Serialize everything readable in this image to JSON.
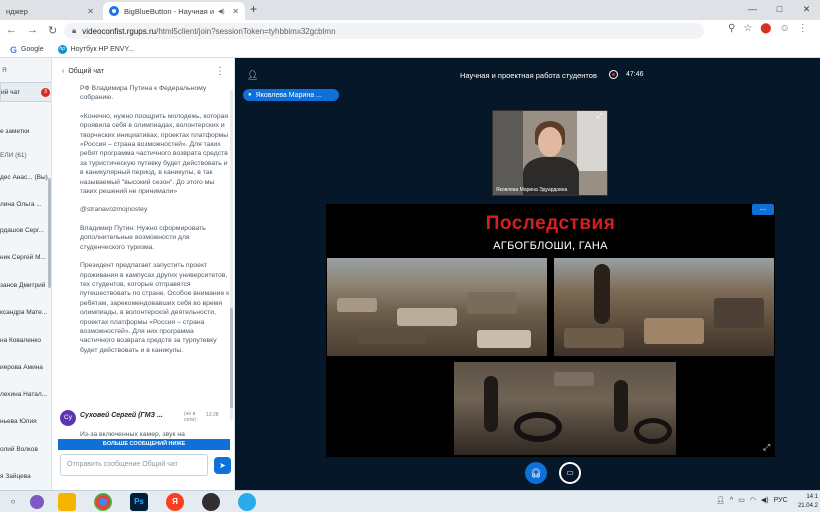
{
  "browser": {
    "tabs": [
      {
        "label": "нджер",
        "icon": "tab-icon"
      },
      {
        "label": "BigBlueButton - Научная и",
        "icon": "bbb-favicon"
      }
    ],
    "new_tab": "+",
    "window_controls": [
      "—",
      "□",
      "✕"
    ],
    "url_host": "videoconfist.rgups.ru",
    "url_path": "/html5client/join?sessionToken=tyhbbimx32gcblmn",
    "bookmarks": [
      {
        "label": "Google",
        "icon": "google-logo"
      },
      {
        "label": "Ноутбук HP ENVY...",
        "icon": "hp-logo"
      }
    ],
    "toolbar_icons": [
      "search-icon",
      "star-icon",
      "extension-icon",
      "profile-icon",
      "menu-icon"
    ]
  },
  "userlist": {
    "section_messages": "Я",
    "chat_item": "ий чат",
    "chat_badge": "3",
    "notes": "е заметки",
    "users_header": "ЕЛИ (61)",
    "users": [
      "дес Анас... (Вы)",
      "лина Ольга ...",
      "рдашов Серг...",
      "ник Сергей М...",
      "занов Дмитрий",
      "ксандра Мате...",
      "на Коваленко",
      "иерова Амина",
      "лехина Натал...",
      "ньева Юлия",
      "олий Волков",
      "я Зайцева"
    ]
  },
  "chat": {
    "title": "Общий чат",
    "messages": [
      "РФ Владимира Путина к Федеральному собранию.",
      "«Конечно, нужно поощрить молодежь, которая проявила себя в олимпиадах, волонтерских и творческих инициативах, проектах платформы «Россия – страна возможностей». Для таких ребят программа частичного возврата средств за туристическую путевку будет действовать и в каникулярный период, в каникулы, в так называемый \"высокий сезон\". До этого мы таких решений не принимали»",
      "@stranavozmojnostey",
      "Владимир Путин: Нужно сформировать дополнительные возможности для студенческого туризма.",
      "Президент предлагает запустить проект проживания в кампусах других университетов, тех студентов, которые отправятся путешествовать по стране. Особое внимание к ребятам, зарекомендовавших себя во время олимпиады, в волонтерской деятельности, проектах платформы «Россия – страна возможностей». Для них программа частичного возврата средств за турпутевку будет действовать и в каникулы."
    ],
    "last_sender": {
      "initials": "Су",
      "name": "Суховей Сергей (ГМЗ ...",
      "time_a": "(не в сети)",
      "time_b": "13:28"
    },
    "last_message": "Из-за включенных камер, звук на",
    "more_messages": "БОЛЬШЕ СООБЩЕНИЙ НИЖЕ",
    "input_placeholder": "Отправить сообщение Общий чат"
  },
  "meeting": {
    "title": "Научная и проектная работа студентов",
    "recording_time": "47:46",
    "talker": "Яковлева Марина ...",
    "webcam_name": "Яковлева Марина Эдуардовна",
    "slide_title": "Последствия",
    "slide_subtitle": "АГБОГБЛОШИ, ГАНА",
    "slide_menu_label": "...",
    "colors": {
      "accent": "#0f70d7",
      "background": "#06172a",
      "slide_title": "#d42020",
      "badge": "#df2721"
    }
  },
  "taskbar": {
    "apps": [
      "search-icon",
      "task-view-icon",
      "file-explorer-icon",
      "chrome-icon",
      "photoshop-icon",
      "yandex-icon",
      "obs-icon",
      "telegram-icon"
    ],
    "ps_label": "Ps",
    "ya_label": "Я",
    "tray_lang": "РУС",
    "clock_time": "14:1",
    "clock_date": "21.04.2"
  }
}
